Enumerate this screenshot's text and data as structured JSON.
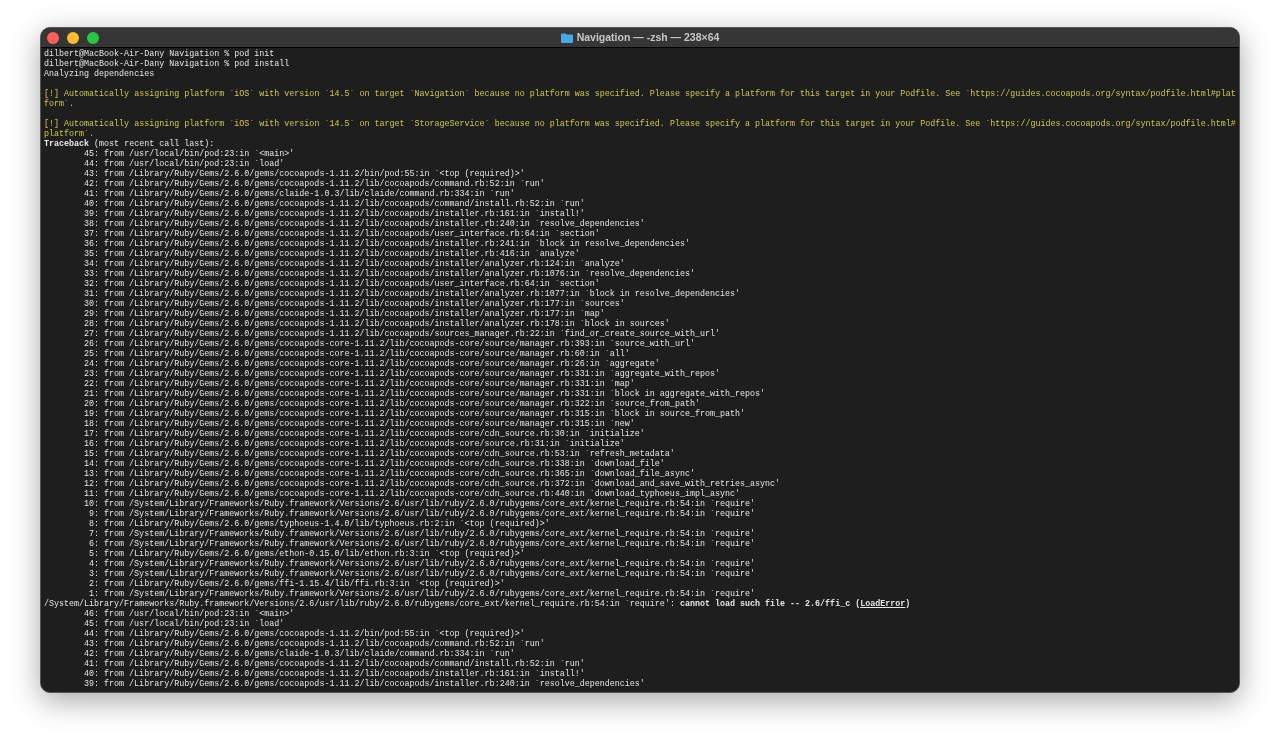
{
  "window": {
    "title": "Navigation — -zsh — 238×64"
  },
  "lines": [
    {
      "kind": "prompt",
      "text": "dilbert@MacBook-Air-Dany Navigation % pod init"
    },
    {
      "kind": "prompt",
      "text": "dilbert@MacBook-Air-Dany Navigation % pod install"
    },
    {
      "kind": "plain",
      "text": "Analyzing dependencies"
    },
    {
      "kind": "warning",
      "text": "[!] Automatically assigning platform `iOS` with version `14.5` on target `Navigation` because no platform was specified. Please specify a platform for this target in your Podfile. See `https://guides.cocoapods.org/syntax/podfile.html#platform`."
    },
    {
      "kind": "warning",
      "text": "[!] Automatically assigning platform `iOS` with version `14.5` on target `StorageService` because no platform was specified. Please specify a platform for this target in your Podfile. See `https://guides.cocoapods.org/syntax/podfile.html#platform`."
    },
    {
      "kind": "plain",
      "text": "**Traceback** (most recent call last):"
    },
    {
      "kind": "frame",
      "text": "45: from /usr/local/bin/pod:23:in `<main>'"
    },
    {
      "kind": "frame",
      "text": "44: from /usr/local/bin/pod:23:in `load'"
    },
    {
      "kind": "frame",
      "text": "43: from /Library/Ruby/Gems/2.6.0/gems/cocoapods-1.11.2/bin/pod:55:in `<top (required)>'"
    },
    {
      "kind": "frame",
      "text": "42: from /Library/Ruby/Gems/2.6.0/gems/cocoapods-1.11.2/lib/cocoapods/command.rb:52:in `run'"
    },
    {
      "kind": "frame",
      "text": "41: from /Library/Ruby/Gems/2.6.0/gems/claide-1.0.3/lib/claide/command.rb:334:in `run'"
    },
    {
      "kind": "frame",
      "text": "40: from /Library/Ruby/Gems/2.6.0/gems/cocoapods-1.11.2/lib/cocoapods/command/install.rb:52:in `run'"
    },
    {
      "kind": "frame",
      "text": "39: from /Library/Ruby/Gems/2.6.0/gems/cocoapods-1.11.2/lib/cocoapods/installer.rb:161:in `install!'"
    },
    {
      "kind": "frame",
      "text": "38: from /Library/Ruby/Gems/2.6.0/gems/cocoapods-1.11.2/lib/cocoapods/installer.rb:240:in `resolve_dependencies'"
    },
    {
      "kind": "frame",
      "text": "37: from /Library/Ruby/Gems/2.6.0/gems/cocoapods-1.11.2/lib/cocoapods/user_interface.rb:64:in `section'"
    },
    {
      "kind": "frame",
      "text": "36: from /Library/Ruby/Gems/2.6.0/gems/cocoapods-1.11.2/lib/cocoapods/installer.rb:241:in `block in resolve_dependencies'"
    },
    {
      "kind": "frame",
      "text": "35: from /Library/Ruby/Gems/2.6.0/gems/cocoapods-1.11.2/lib/cocoapods/installer.rb:416:in `analyze'"
    },
    {
      "kind": "frame",
      "text": "34: from /Library/Ruby/Gems/2.6.0/gems/cocoapods-1.11.2/lib/cocoapods/installer/analyzer.rb:124:in `analyze'"
    },
    {
      "kind": "frame",
      "text": "33: from /Library/Ruby/Gems/2.6.0/gems/cocoapods-1.11.2/lib/cocoapods/installer/analyzer.rb:1076:in `resolve_dependencies'"
    },
    {
      "kind": "frame",
      "text": "32: from /Library/Ruby/Gems/2.6.0/gems/cocoapods-1.11.2/lib/cocoapods/user_interface.rb:64:in `section'"
    },
    {
      "kind": "frame",
      "text": "31: from /Library/Ruby/Gems/2.6.0/gems/cocoapods-1.11.2/lib/cocoapods/installer/analyzer.rb:1077:in `block in resolve_dependencies'"
    },
    {
      "kind": "frame",
      "text": "30: from /Library/Ruby/Gems/2.6.0/gems/cocoapods-1.11.2/lib/cocoapods/installer/analyzer.rb:177:in `sources'"
    },
    {
      "kind": "frame",
      "text": "29: from /Library/Ruby/Gems/2.6.0/gems/cocoapods-1.11.2/lib/cocoapods/installer/analyzer.rb:177:in `map'"
    },
    {
      "kind": "frame",
      "text": "28: from /Library/Ruby/Gems/2.6.0/gems/cocoapods-1.11.2/lib/cocoapods/installer/analyzer.rb:178:in `block in sources'"
    },
    {
      "kind": "frame",
      "text": "27: from /Library/Ruby/Gems/2.6.0/gems/cocoapods-1.11.2/lib/cocoapods/sources_manager.rb:22:in `find_or_create_source_with_url'"
    },
    {
      "kind": "frame",
      "text": "26: from /Library/Ruby/Gems/2.6.0/gems/cocoapods-core-1.11.2/lib/cocoapods-core/source/manager.rb:393:in `source_with_url'"
    },
    {
      "kind": "frame",
      "text": "25: from /Library/Ruby/Gems/2.6.0/gems/cocoapods-core-1.11.2/lib/cocoapods-core/source/manager.rb:60:in `all'"
    },
    {
      "kind": "frame",
      "text": "24: from /Library/Ruby/Gems/2.6.0/gems/cocoapods-core-1.11.2/lib/cocoapods-core/source/manager.rb:26:in `aggregate'"
    },
    {
      "kind": "frame",
      "text": "23: from /Library/Ruby/Gems/2.6.0/gems/cocoapods-core-1.11.2/lib/cocoapods-core/source/manager.rb:331:in `aggregate_with_repos'"
    },
    {
      "kind": "frame",
      "text": "22: from /Library/Ruby/Gems/2.6.0/gems/cocoapods-core-1.11.2/lib/cocoapods-core/source/manager.rb:331:in `map'"
    },
    {
      "kind": "frame",
      "text": "21: from /Library/Ruby/Gems/2.6.0/gems/cocoapods-core-1.11.2/lib/cocoapods-core/source/manager.rb:331:in `block in aggregate_with_repos'"
    },
    {
      "kind": "frame",
      "text": "20: from /Library/Ruby/Gems/2.6.0/gems/cocoapods-core-1.11.2/lib/cocoapods-core/source/manager.rb:322:in `source_from_path'"
    },
    {
      "kind": "frame",
      "text": "19: from /Library/Ruby/Gems/2.6.0/gems/cocoapods-core-1.11.2/lib/cocoapods-core/source/manager.rb:315:in `block in source_from_path'"
    },
    {
      "kind": "frame",
      "text": "18: from /Library/Ruby/Gems/2.6.0/gems/cocoapods-core-1.11.2/lib/cocoapods-core/source/manager.rb:315:in `new'"
    },
    {
      "kind": "frame",
      "text": "17: from /Library/Ruby/Gems/2.6.0/gems/cocoapods-core-1.11.2/lib/cocoapods-core/cdn_source.rb:30:in `initialize'"
    },
    {
      "kind": "frame",
      "text": "16: from /Library/Ruby/Gems/2.6.0/gems/cocoapods-core-1.11.2/lib/cocoapods-core/source.rb:31:in `initialize'"
    },
    {
      "kind": "frame",
      "text": "15: from /Library/Ruby/Gems/2.6.0/gems/cocoapods-core-1.11.2/lib/cocoapods-core/cdn_source.rb:53:in `refresh_metadata'"
    },
    {
      "kind": "frame",
      "text": "14: from /Library/Ruby/Gems/2.6.0/gems/cocoapods-core-1.11.2/lib/cocoapods-core/cdn_source.rb:338:in `download_file'"
    },
    {
      "kind": "frame",
      "text": "13: from /Library/Ruby/Gems/2.6.0/gems/cocoapods-core-1.11.2/lib/cocoapods-core/cdn_source.rb:365:in `download_file_async'"
    },
    {
      "kind": "frame",
      "text": "12: from /Library/Ruby/Gems/2.6.0/gems/cocoapods-core-1.11.2/lib/cocoapods-core/cdn_source.rb:372:in `download_and_save_with_retries_async'"
    },
    {
      "kind": "frame",
      "text": "11: from /Library/Ruby/Gems/2.6.0/gems/cocoapods-core-1.11.2/lib/cocoapods-core/cdn_source.rb:440:in `download_typhoeus_impl_async'"
    },
    {
      "kind": "frame",
      "text": "10: from /System/Library/Frameworks/Ruby.framework/Versions/2.6/usr/lib/ruby/2.6.0/rubygems/core_ext/kernel_require.rb:54:in `require'"
    },
    {
      "kind": "frame",
      "text": " 9: from /System/Library/Frameworks/Ruby.framework/Versions/2.6/usr/lib/ruby/2.6.0/rubygems/core_ext/kernel_require.rb:54:in `require'"
    },
    {
      "kind": "frame",
      "text": " 8: from /Library/Ruby/Gems/2.6.0/gems/typhoeus-1.4.0/lib/typhoeus.rb:2:in `<top (required)>'"
    },
    {
      "kind": "frame",
      "text": " 7: from /System/Library/Frameworks/Ruby.framework/Versions/2.6/usr/lib/ruby/2.6.0/rubygems/core_ext/kernel_require.rb:54:in `require'"
    },
    {
      "kind": "frame",
      "text": " 6: from /System/Library/Frameworks/Ruby.framework/Versions/2.6/usr/lib/ruby/2.6.0/rubygems/core_ext/kernel_require.rb:54:in `require'"
    },
    {
      "kind": "frame",
      "text": " 5: from /Library/Ruby/Gems/2.6.0/gems/ethon-0.15.0/lib/ethon.rb:3:in `<top (required)>'"
    },
    {
      "kind": "frame",
      "text": " 4: from /System/Library/Frameworks/Ruby.framework/Versions/2.6/usr/lib/ruby/2.6.0/rubygems/core_ext/kernel_require.rb:54:in `require'"
    },
    {
      "kind": "frame",
      "text": " 3: from /System/Library/Frameworks/Ruby.framework/Versions/2.6/usr/lib/ruby/2.6.0/rubygems/core_ext/kernel_require.rb:54:in `require'"
    },
    {
      "kind": "frame",
      "text": " 2: from /Library/Ruby/Gems/2.6.0/gems/ffi-1.15.4/lib/ffi.rb:3:in `<top (required)>'"
    },
    {
      "kind": "frame",
      "text": " 1: from /System/Library/Frameworks/Ruby.framework/Versions/2.6/usr/lib/ruby/2.6.0/rubygems/core_ext/kernel_require.rb:54:in `require'"
    },
    {
      "kind": "error",
      "text": "/System/Library/Frameworks/Ruby.framework/Versions/2.6/usr/lib/ruby/2.6.0/rubygems/core_ext/kernel_require.rb:54:in `require': **cannot load such file -- 2.6/ffi_c (**",
      "error_class": "LoadError",
      "text_after": "**)**"
    },
    {
      "kind": "frame",
      "text": "46: from /usr/local/bin/pod:23:in `<main>'"
    },
    {
      "kind": "frame",
      "text": "45: from /usr/local/bin/pod:23:in `load'"
    },
    {
      "kind": "frame",
      "text": "44: from /Library/Ruby/Gems/2.6.0/gems/cocoapods-1.11.2/bin/pod:55:in `<top (required)>'"
    },
    {
      "kind": "frame",
      "text": "43: from /Library/Ruby/Gems/2.6.0/gems/cocoapods-1.11.2/lib/cocoapods/command.rb:52:in `run'"
    },
    {
      "kind": "frame",
      "text": "42: from /Library/Ruby/Gems/2.6.0/gems/claide-1.0.3/lib/claide/command.rb:334:in `run'"
    },
    {
      "kind": "frame",
      "text": "41: from /Library/Ruby/Gems/2.6.0/gems/cocoapods-1.11.2/lib/cocoapods/command/install.rb:52:in `run'"
    },
    {
      "kind": "frame",
      "text": "40: from /Library/Ruby/Gems/2.6.0/gems/cocoapods-1.11.2/lib/cocoapods/installer.rb:161:in `install!'"
    },
    {
      "kind": "frame",
      "text": "39: from /Library/Ruby/Gems/2.6.0/gems/cocoapods-1.11.2/lib/cocoapods/installer.rb:240:in `resolve_dependencies'"
    }
  ]
}
